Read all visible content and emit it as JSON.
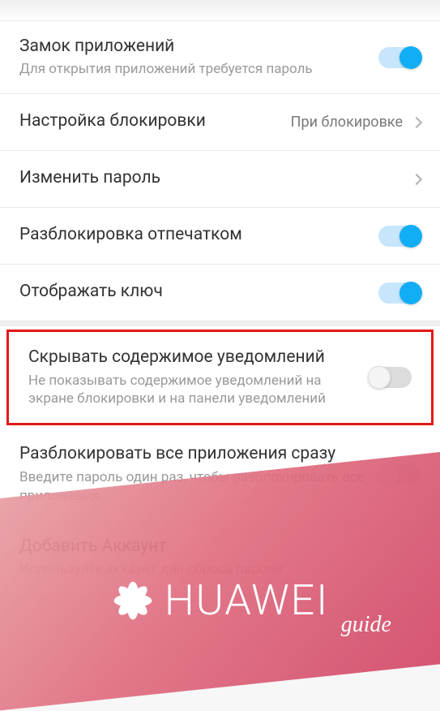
{
  "settings": [
    {
      "title": "Замок приложений",
      "subtitle": "Для открытия приложений требуется пароль",
      "control": "toggle",
      "state": "on"
    },
    {
      "title": "Настройка блокировки",
      "value": "При блокировке",
      "control": "chevron"
    },
    {
      "title": "Изменить пароль",
      "control": "chevron"
    },
    {
      "title": "Разблокировка отпечатком",
      "control": "toggle",
      "state": "on"
    },
    {
      "title": "Отображать ключ",
      "control": "toggle",
      "state": "on"
    },
    {
      "title": "Скрывать содержимое уведомлений",
      "subtitle": "Не показывать содержимое уведомлений на экране блокировки и на панели уведомлений",
      "control": "toggle",
      "state": "off",
      "highlight": true
    },
    {
      "title": "Разблокировать все приложения сразу",
      "subtitle": "Введите пароль один раз, чтобы разблокировать все приложения",
      "control": "toggle",
      "state": "off"
    },
    {
      "title": "Добавить Аккаунт",
      "subtitle": "Используйте аккаунт для сброса пароля",
      "control": "none",
      "faded": true
    }
  ],
  "watermark": {
    "brand": "HUAWEI",
    "sub": "guide"
  }
}
